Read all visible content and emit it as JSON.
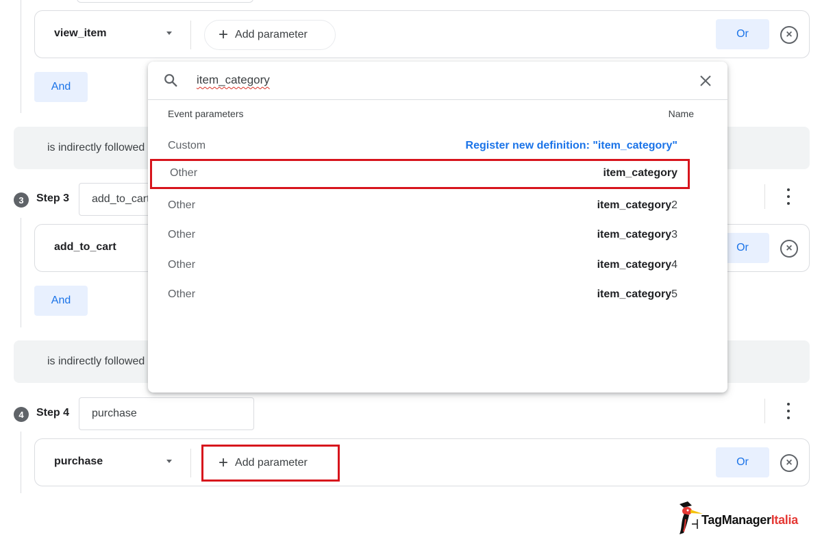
{
  "top_step_input": {
    "value": ""
  },
  "step2": {
    "event_name": "view_item",
    "add_parameter_label": "Add parameter",
    "or_label": "Or",
    "and_label": "And"
  },
  "follow_bar_1": {
    "text": "is indirectly followed by"
  },
  "step3": {
    "number": "3",
    "label": "Step 3",
    "input_value": "add_to_cart",
    "event_name": "add_to_cart",
    "or_label": "Or",
    "and_label": "And"
  },
  "follow_bar_2": {
    "text": "is indirectly followed by"
  },
  "step4": {
    "number": "4",
    "label": "Step 4",
    "input_value": "purchase",
    "event_name": "purchase",
    "add_parameter_label": "Add parameter",
    "or_label": "Or"
  },
  "dropdown": {
    "search_query": "item_category",
    "header_left": "Event parameters",
    "header_right": "Name",
    "rows": [
      {
        "type": "Custom",
        "register_label": "Register new definition: \"item_category\""
      },
      {
        "type": "Other",
        "name_bold": "item_category",
        "name_suffix": "",
        "selected": true
      },
      {
        "type": "Other",
        "name_bold": "item_category",
        "name_suffix": "2"
      },
      {
        "type": "Other",
        "name_bold": "item_category",
        "name_suffix": "3"
      },
      {
        "type": "Other",
        "name_bold": "item_category",
        "name_suffix": "4"
      },
      {
        "type": "Other",
        "name_bold": "item_category",
        "name_suffix": "5"
      }
    ]
  },
  "logo": {
    "brand_main": "TagManager",
    "brand_accent": "Italia"
  },
  "colors": {
    "accent_blue": "#1a73e8",
    "chip_bg": "#e8f0fe",
    "highlight_red": "#d7141c",
    "logo_red": "#e53935"
  }
}
